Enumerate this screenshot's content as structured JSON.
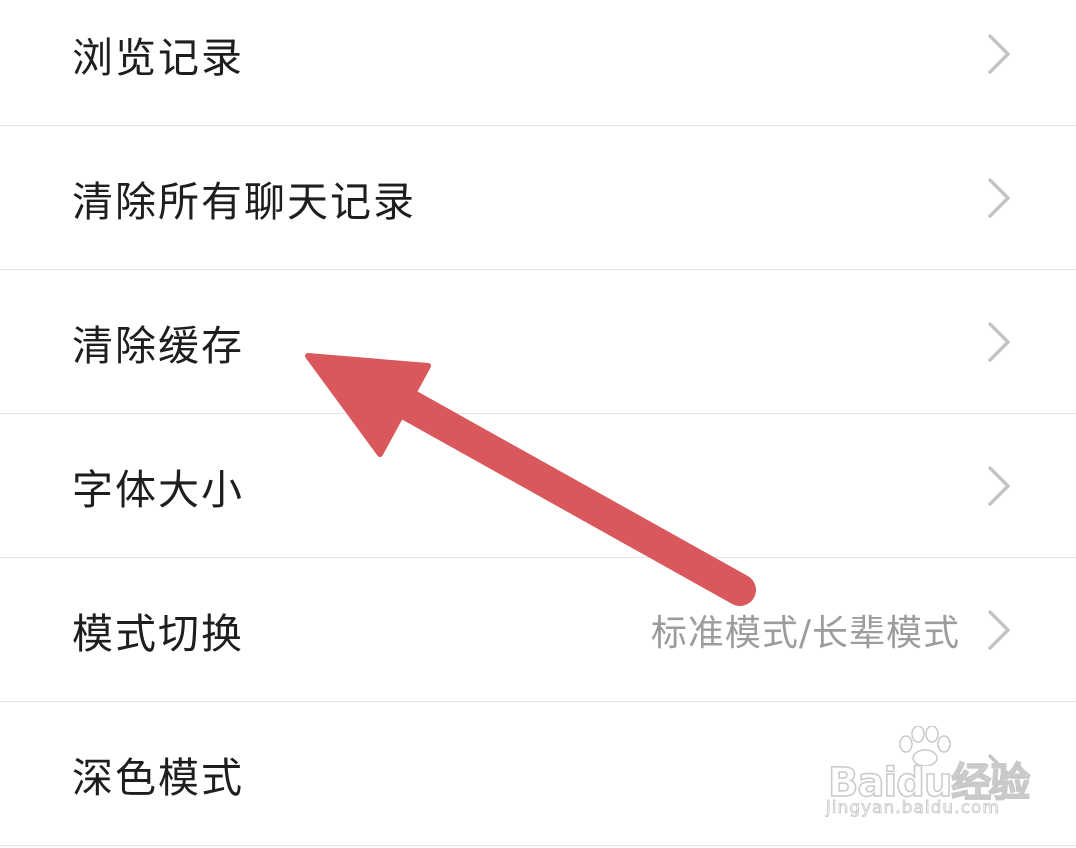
{
  "settings": {
    "items": [
      {
        "label": "浏览记录",
        "value": ""
      },
      {
        "label": "清除所有聊天记录",
        "value": ""
      },
      {
        "label": "清除缓存",
        "value": ""
      },
      {
        "label": "字体大小",
        "value": ""
      },
      {
        "label": "模式切换",
        "value": "标准模式/长辈模式"
      },
      {
        "label": "深色模式",
        "value": ""
      }
    ]
  },
  "annotation": {
    "arrow_color": "#d9585c",
    "points_to": "清除缓存"
  },
  "watermark": {
    "logo": "Baidu经验",
    "url": "jingyan.baidu.com"
  },
  "colors": {
    "label": "#1e1e1e",
    "value": "#9c9c9c",
    "chevron": "#c4c4c4",
    "divider": "#e3e3e3"
  },
  "icons": {
    "chevron": "chevron-right-icon",
    "watermark": "baidu-paw-icon"
  }
}
